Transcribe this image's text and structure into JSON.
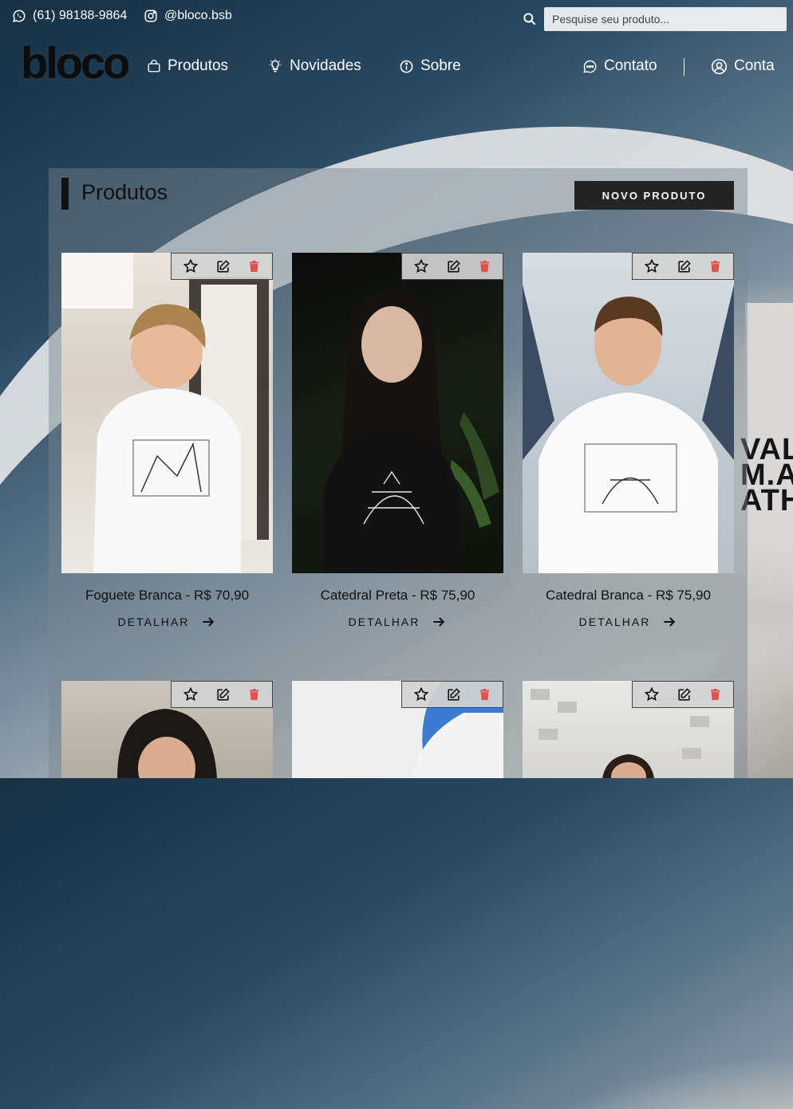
{
  "contact": {
    "phone": "(61) 98188-9864",
    "instagram": "@bloco.bsb"
  },
  "search": {
    "placeholder": "Pesquise seu produto..."
  },
  "brand": {
    "logo": "bloco"
  },
  "nav": {
    "produtos": "Produtos",
    "novidades": "Novidades",
    "sobre": "Sobre",
    "contato": "Contato",
    "conta": "Conta"
  },
  "panel": {
    "title": "Produtos",
    "new_button": "NOVO PRODUTO"
  },
  "background_text": "VAL\nM.A\nATH",
  "products": [
    {
      "name": "Foguete Branca - R$ 70,90",
      "detail": "DETALHAR"
    },
    {
      "name": "Catedral Preta - R$ 75,90",
      "detail": "DETALHAR"
    },
    {
      "name": "Catedral Branca - R$ 75,90",
      "detail": "DETALHAR"
    },
    {
      "name": "",
      "detail": ""
    },
    {
      "name": "",
      "detail": ""
    },
    {
      "name": "",
      "detail": ""
    }
  ],
  "colors": {
    "accent_dark": "#242424",
    "delete_icon": "#e05252",
    "header_text": "#ffffff"
  }
}
